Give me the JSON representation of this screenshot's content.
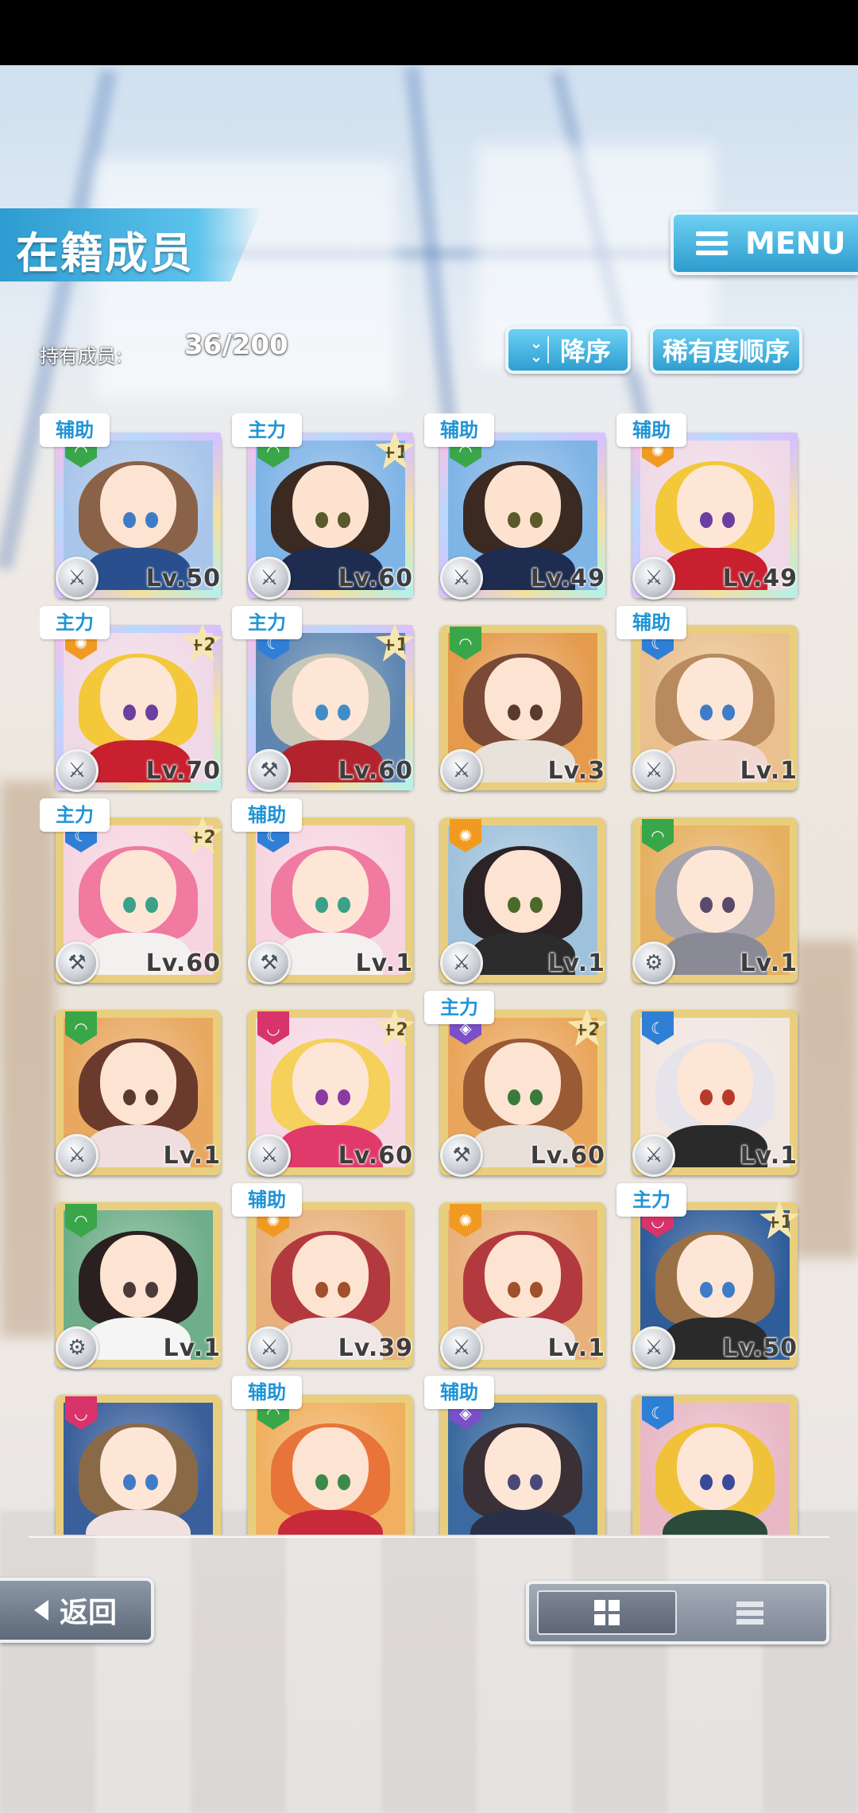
{
  "header": {
    "title": "在籍成员",
    "menu_label": "MENU",
    "member_count_label": "持有成员:",
    "member_count_value": "36/200"
  },
  "sort": {
    "order_label": "降序",
    "type_label": "稀有度顺序"
  },
  "footer": {
    "back_label": "返回"
  },
  "colors": {
    "accent": "#2d9ccf",
    "tag_text": "#1f94d6",
    "gold_frame": "#e9cf7d",
    "attr_green": "#3aa64a",
    "attr_orange": "#f19a21",
    "attr_blue": "#2f7fd6",
    "attr_pink": "#d8336a",
    "attr_purple": "#7a4fc7"
  },
  "members": [
    {
      "role": "辅助",
      "plus": "",
      "level": "Lv.50",
      "weapon": "sword-icon",
      "attr": "green",
      "rainbow": true,
      "hair": "#8a6247",
      "skin": "#fde3d2",
      "eyes": "#3f7cc7",
      "outfit": "#2a4f8f",
      "bg": "#a9c6ea"
    },
    {
      "role": "主力",
      "plus": "+1",
      "level": "Lv.60",
      "weapon": "sword-icon",
      "attr": "green",
      "rainbow": true,
      "hair": "#3a2a22",
      "skin": "#fde2cf",
      "eyes": "#5a5a2a",
      "outfit": "#1d2c4f",
      "bg": "#7fb4e6"
    },
    {
      "role": "辅助",
      "plus": "",
      "level": "Lv.49",
      "weapon": "sword-icon",
      "attr": "green",
      "rainbow": true,
      "hair": "#3a2a22",
      "skin": "#fde2cf",
      "eyes": "#5a5a2a",
      "outfit": "#1d2c4f",
      "bg": "#7fb4e6"
    },
    {
      "role": "辅助",
      "plus": "",
      "level": "Lv.49",
      "weapon": "sword-icon",
      "attr": "orange",
      "rainbow": true,
      "hair": "#f3c83a",
      "skin": "#fde6d6",
      "eyes": "#6a3fa0",
      "outfit": "#c8202e",
      "bg": "#f0d9e6"
    },
    {
      "role": "主力",
      "plus": "+2",
      "level": "Lv.70",
      "weapon": "sword-icon",
      "attr": "orange",
      "rainbow": true,
      "hair": "#f3c83a",
      "skin": "#fde6d6",
      "eyes": "#6a3fa0",
      "outfit": "#c8202e",
      "bg": "#f0d9e6"
    },
    {
      "role": "主力",
      "plus": "+1",
      "level": "Lv.60",
      "weapon": "hammer-icon",
      "attr": "blue",
      "rainbow": true,
      "hair": "#c9c7b8",
      "skin": "#fde6d6",
      "eyes": "#3f8cc7",
      "outfit": "#b3232e",
      "bg": "#5f86b0"
    },
    {
      "role": "",
      "plus": "",
      "level": "Lv.3",
      "weapon": "sword-icon",
      "attr": "green",
      "rainbow": false,
      "hair": "#7a4a36",
      "skin": "#fde3d2",
      "eyes": "#5a3a2a",
      "outfit": "#e8e2da",
      "bg": "#e59a4c"
    },
    {
      "role": "辅助",
      "plus": "",
      "level": "Lv.1",
      "weapon": "sword-icon",
      "attr": "blue",
      "rainbow": false,
      "hair": "#b88a5e",
      "skin": "#fde6d6",
      "eyes": "#3f7cc7",
      "outfit": "#f2d8d0",
      "bg": "#eac08e"
    },
    {
      "role": "主力",
      "plus": "+2",
      "level": "Lv.60",
      "weapon": "hammer-icon",
      "attr": "blue",
      "rainbow": false,
      "hair": "#f07aa0",
      "skin": "#fde6d6",
      "eyes": "#3aa08a",
      "outfit": "#f5f0f0",
      "bg": "#f7d5e0"
    },
    {
      "role": "辅助",
      "plus": "",
      "level": "Lv.1",
      "weapon": "hammer-icon",
      "attr": "blue",
      "rainbow": false,
      "hair": "#f07aa0",
      "skin": "#fde6d6",
      "eyes": "#3aa08a",
      "outfit": "#f5f0f0",
      "bg": "#f7d5e0"
    },
    {
      "role": "",
      "plus": "",
      "level": "Lv.1",
      "weapon": "sword-icon",
      "attr": "orange",
      "rainbow": false,
      "hair": "#2b2326",
      "skin": "#fde3d2",
      "eyes": "#4a6a2a",
      "outfit": "#2c2c2c",
      "bg": "#9fc2dc"
    },
    {
      "role": "",
      "plus": "",
      "level": "Lv.1",
      "weapon": "gear-icon",
      "attr": "green",
      "rainbow": false,
      "hair": "#a6a3ad",
      "skin": "#fde6d6",
      "eyes": "#5a4a6a",
      "outfit": "#8a8a96",
      "bg": "#e6b060"
    },
    {
      "role": "",
      "plus": "",
      "level": "Lv.1",
      "weapon": "sword-icon",
      "attr": "green",
      "rainbow": false,
      "hair": "#6a3a2c",
      "skin": "#fde3d2",
      "eyes": "#5a3a2a",
      "outfit": "#f0dede",
      "bg": "#e8a860"
    },
    {
      "role": "",
      "plus": "+2",
      "level": "Lv.60",
      "weapon": "sword-icon",
      "attr": "pink",
      "rainbow": false,
      "hair": "#f5d05a",
      "skin": "#fde6d6",
      "eyes": "#8a3aa0",
      "outfit": "#e03a6a",
      "bg": "#f6d8e4"
    },
    {
      "role": "主力",
      "plus": "+2",
      "level": "Lv.60",
      "weapon": "hammer-icon",
      "attr": "purple",
      "rainbow": false,
      "hair": "#9a5a34",
      "skin": "#fde3d2",
      "eyes": "#3a7a3a",
      "outfit": "#e8e0d8",
      "bg": "#e9a55a"
    },
    {
      "role": "",
      "plus": "",
      "level": "Lv.1",
      "weapon": "sword-icon",
      "attr": "blue",
      "rainbow": false,
      "hair": "#e6e4ea",
      "skin": "#fde6d6",
      "eyes": "#b83a2a",
      "outfit": "#2a2a2a",
      "bg": "#f2e6e0"
    },
    {
      "role": "",
      "plus": "",
      "level": "Lv.1",
      "weapon": "gear-icon",
      "attr": "green",
      "rainbow": false,
      "hair": "#2a2020",
      "skin": "#fde3d2",
      "eyes": "#4a3a3a",
      "outfit": "#f5f5f5",
      "bg": "#6fae8a"
    },
    {
      "role": "辅助",
      "plus": "",
      "level": "Lv.39",
      "weapon": "sword-icon",
      "attr": "orange",
      "rainbow": false,
      "hair": "#b23a3e",
      "skin": "#fde3d2",
      "eyes": "#a0502a",
      "outfit": "#f0e6e6",
      "bg": "#e8b07a"
    },
    {
      "role": "",
      "plus": "",
      "level": "Lv.1",
      "weapon": "sword-icon",
      "attr": "orange",
      "rainbow": false,
      "hair": "#b23a3e",
      "skin": "#fde3d2",
      "eyes": "#a0502a",
      "outfit": "#f0e6e6",
      "bg": "#e8b07a"
    },
    {
      "role": "主力",
      "plus": "+1",
      "level": "Lv.50",
      "weapon": "sword-icon",
      "attr": "pink",
      "rainbow": false,
      "hair": "#9a7046",
      "skin": "#fde6d6",
      "eyes": "#3f7cc7",
      "outfit": "#2a2a2a",
      "bg": "#2f5d9a"
    },
    {
      "role": "",
      "plus": "",
      "level": "",
      "weapon": "",
      "attr": "pink",
      "rainbow": false,
      "hair": "#8a6a46",
      "skin": "#fde6d6",
      "eyes": "#3f7cc7",
      "outfit": "#f0e0e0",
      "bg": "#3a5f9a"
    },
    {
      "role": "辅助",
      "plus": "",
      "level": "",
      "weapon": "",
      "attr": "green",
      "rainbow": false,
      "hair": "#e8743a",
      "skin": "#fde3d2",
      "eyes": "#3a8a4a",
      "outfit": "#c82a3a",
      "bg": "#f0b060"
    },
    {
      "role": "辅助",
      "plus": "",
      "level": "",
      "weapon": "",
      "attr": "purple",
      "rainbow": false,
      "hair": "#3a3036",
      "skin": "#fde6d6",
      "eyes": "#4a4a7a",
      "outfit": "#2a2f4a",
      "bg": "#3a6aa0"
    },
    {
      "role": "",
      "plus": "",
      "level": "",
      "weapon": "",
      "attr": "blue",
      "rainbow": false,
      "hair": "#f0c23a",
      "skin": "#fde6d6",
      "eyes": "#3a4a9a",
      "outfit": "#2a4a3a",
      "bg": "#e8b8c6"
    }
  ]
}
